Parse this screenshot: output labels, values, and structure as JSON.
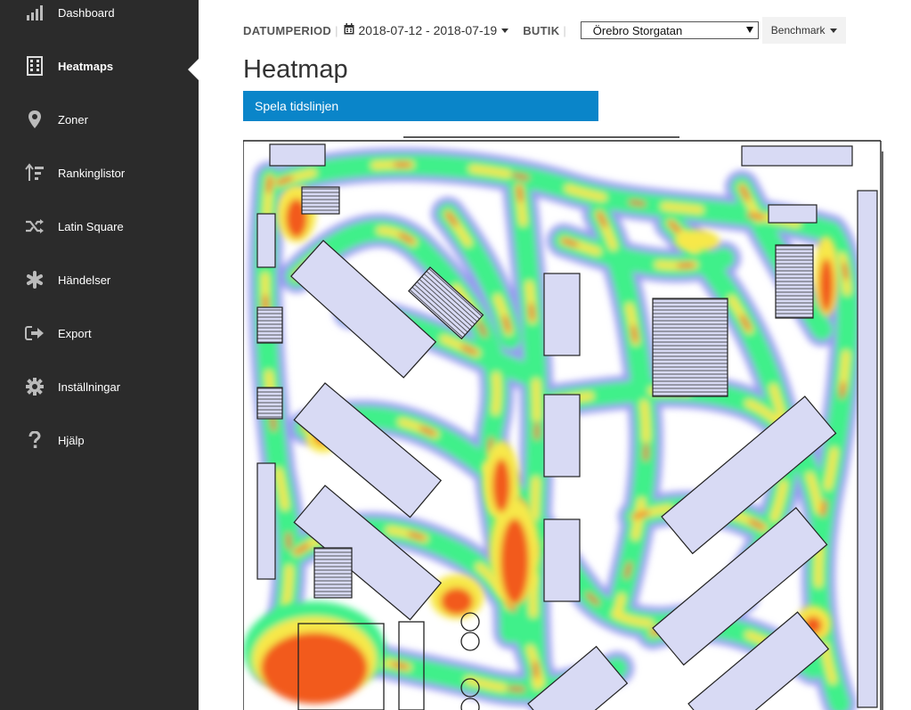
{
  "sidebar": {
    "items": [
      {
        "label": "Dashboard",
        "icon": "signal-bars-icon"
      },
      {
        "label": "Heatmaps",
        "icon": "building-icon",
        "active": true
      },
      {
        "label": "Zoner",
        "icon": "map-pin-icon"
      },
      {
        "label": "Rankinglistor",
        "icon": "sort-ranking-icon"
      },
      {
        "label": "Latin Square",
        "icon": "shuffle-icon"
      },
      {
        "label": "Händelser",
        "icon": "asterisk-icon"
      },
      {
        "label": "Export",
        "icon": "export-icon"
      },
      {
        "label": "Inställningar",
        "icon": "gear-icon"
      },
      {
        "label": "Hjälp",
        "icon": "question-icon"
      }
    ]
  },
  "header": {
    "period_label": "DATUMPERIOD",
    "date_range": "2018-07-12 - 2018-07-19",
    "store_label": "BUTIK",
    "store_value": "Örebro Storgatan",
    "benchmark_label": "Benchmark"
  },
  "page": {
    "title": "Heatmap",
    "play_button": "Spela tidslinjen"
  },
  "colors": {
    "sidebar_bg": "#2b2b2b",
    "accent": "#0a85c9",
    "heat_hot": "#f25a1f",
    "heat_warm": "#f7e84a",
    "heat_mid": "#3ff08a",
    "heat_cool": "#9a9af2"
  }
}
